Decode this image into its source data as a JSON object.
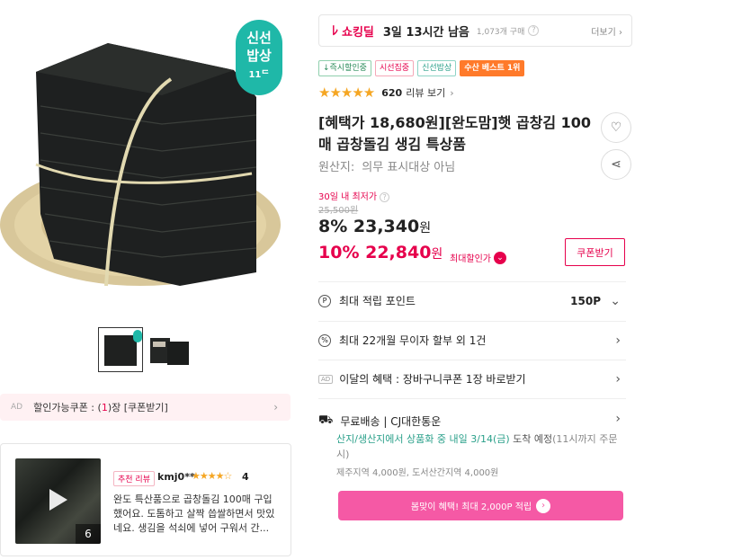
{
  "product_badge": {
    "line1": "신선",
    "line2": "밥상",
    "line3": "11ᄃ"
  },
  "coupon_bar": {
    "ad": "AD",
    "prefix": "할인가능쿠폰 : (",
    "count": "1",
    "suffix": ")장 [쿠폰받기]"
  },
  "review": {
    "tag": "추천 리뷰",
    "user": "kmj0**",
    "stars": "★★★★☆",
    "score": "4",
    "text": "완도 특산품으로 곱창돌김 100매 구입했어요. 도톰하고 살짝 씁쌀하면서 맛있네요. 생김을 석쇠에 넣어 구워서 간...",
    "media_count": "6"
  },
  "shocking": {
    "label": "쇼킹딜",
    "time_left": "3일 13시간 남음",
    "sold": "1,073개 구매",
    "more": "더보기"
  },
  "badges": [
    "↓즉시할인중",
    "시선집중",
    "신선밥상",
    "수산 베스트 1위"
  ],
  "rating": {
    "stars": "★★★★★",
    "count": "620",
    "label": "리뷰 보기"
  },
  "product": {
    "title": "[혜택가 18,680원][완도맘]햇 곱창김 100매 곱창돌김 생김 특상품",
    "origin_label": "원산지:",
    "origin_value": "의무 표시대상 아님"
  },
  "price": {
    "lowest_label": "30일 내 최저가",
    "original": "25,500원",
    "discount1": "8% 23,340",
    "discount2": "10% 22,840",
    "won": "원",
    "max_tag": "최대할인가",
    "coupon_button": "쿠폰받기"
  },
  "rows": {
    "points_label": "최대 적립 포인트",
    "points_value": "150P",
    "installment": "최대 22개월 무이자 할부 외 1건",
    "ad_label": "AD",
    "monthly_benefit": "이달의 혜택 : 장바구니쿠폰 1장 바로받기",
    "shipping": "무료배송 | CJ대한통운"
  },
  "shipping": {
    "highlight": "산지/생산지에서 상품화 중 내일 3/14(금)",
    "schedule": " 도착 예정",
    "note": "(11시까지 주문 시)",
    "sub": "제주지역 4,000원, 도서산간지역 4,000원"
  },
  "promo": {
    "text": "봄맞이 혜택! 최대 2,000P 적립"
  }
}
